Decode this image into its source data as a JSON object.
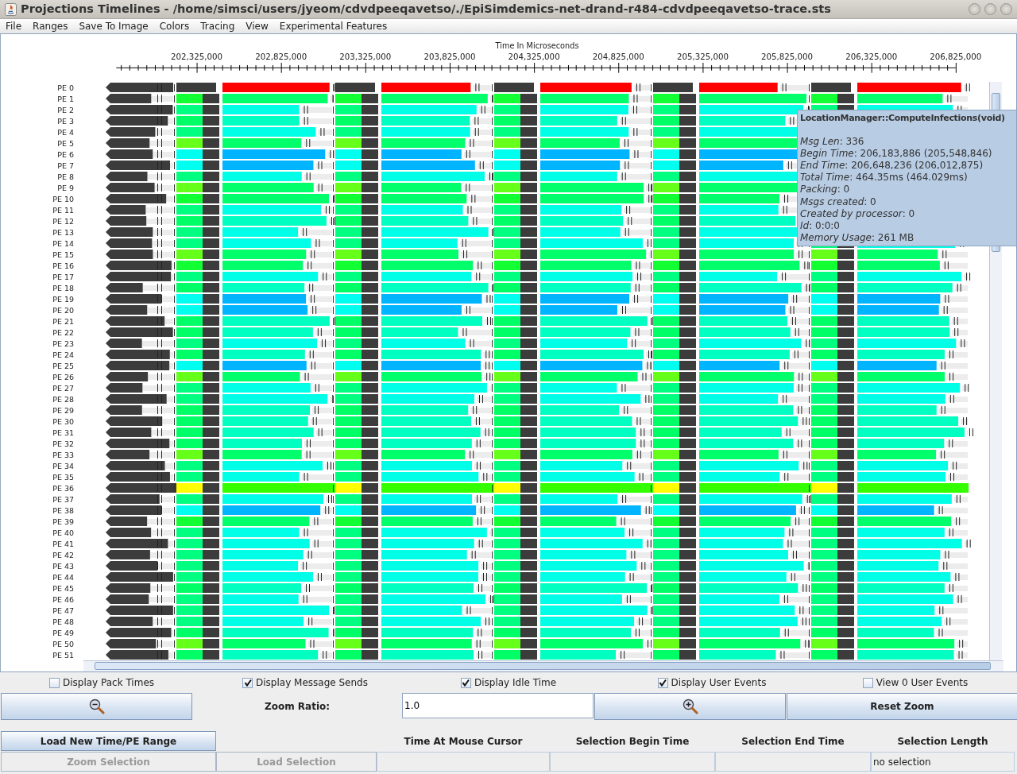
{
  "window": {
    "title": "Projections Timelines - /home/simsci/users/jyeom/cdvdpeeqavetso/./EpiSimdemics-net-drand-r484-cdvdpeeqavetso-trace.sts"
  },
  "menu": [
    "File",
    "Ranges",
    "Save To Image",
    "Colors",
    "Tracing",
    "View",
    "Experimental Features"
  ],
  "axis": {
    "title": "Time In Microseconds",
    "tick_labels": [
      "202,325,000",
      "202,825,000",
      "203,325,000",
      "203,825,000",
      "204,325,000",
      "204,825,000",
      "205,325,000",
      "205,825,000",
      "206,325,000",
      "206,825,000"
    ]
  },
  "pe_labels": [
    "PE 0",
    "PE 1",
    "PE 2",
    "PE 3",
    "PE 4",
    "PE 5",
    "PE 6",
    "PE 7",
    "PE 8",
    "PE 9",
    "PE 10",
    "PE 11",
    "PE 12",
    "PE 13",
    "PE 14",
    "PE 15",
    "PE 16",
    "PE 17",
    "PE 18",
    "PE 19",
    "PE 20",
    "PE 21",
    "PE 22",
    "PE 23",
    "PE 24",
    "PE 25",
    "PE 26",
    "PE 27",
    "PE 28",
    "PE 29",
    "PE 30",
    "PE 31",
    "PE 32",
    "PE 33",
    "PE 34",
    "PE 35",
    "PE 36",
    "PE 37",
    "PE 38",
    "PE 39",
    "PE 40",
    "PE 41",
    "PE 42",
    "PE 43",
    "PE 44",
    "PE 45",
    "PE 46",
    "PE 47",
    "PE 48",
    "PE 49",
    "PE 50",
    "PE 51"
  ],
  "tooltip": {
    "title": "LocationManager::ComputeInfections(void)",
    "lines": [
      "*Msg Len*: 336",
      "*Begin Time*: 206,183,886 (205,548,846)",
      "*End Time*: 206,648,236 (206,012,875)",
      "*Total Time*: 464.35ms (464.029ms)",
      "*Packing*: 0",
      "*Msgs created*: 0",
      "*Created by processor*: 0",
      "*Id*: 0:0:0",
      "*Memory Usage*: 261 MB"
    ]
  },
  "checkboxes": [
    {
      "label": "Display Pack Times",
      "checked": false
    },
    {
      "label": "Display Message Sends",
      "checked": true
    },
    {
      "label": "Display Idle Time",
      "checked": true
    },
    {
      "label": "Display User Events",
      "checked": true
    },
    {
      "label": "View 0 User Events",
      "checked": false
    }
  ],
  "zoom": {
    "label": "Zoom Ratio:",
    "value": "1.0",
    "reset_label": "Reset Zoom"
  },
  "buttons": [
    {
      "label": "Load New Time/PE Range",
      "disabled": false
    },
    {
      "label": "Zoom Selection",
      "disabled": true
    },
    {
      "label": "Load Selection",
      "disabled": true
    }
  ],
  "selection_table": {
    "columns": [
      "Time At Mouse Cursor",
      "Selection Begin Time",
      "Selection End Time",
      "Selection Length"
    ],
    "status": "no selection"
  }
}
